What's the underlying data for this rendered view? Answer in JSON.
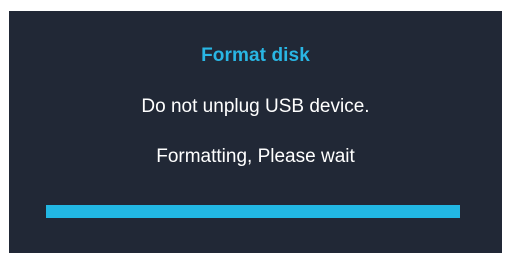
{
  "dialog": {
    "title": "Format disk",
    "message_line1": "Do not unplug USB device.",
    "message_line2": "Formatting, Please wait",
    "progress": 1.0
  },
  "colors": {
    "background": "#212836",
    "title": "#29b6e4",
    "text": "#ffffff",
    "progress_fill": "#22b7e3"
  }
}
